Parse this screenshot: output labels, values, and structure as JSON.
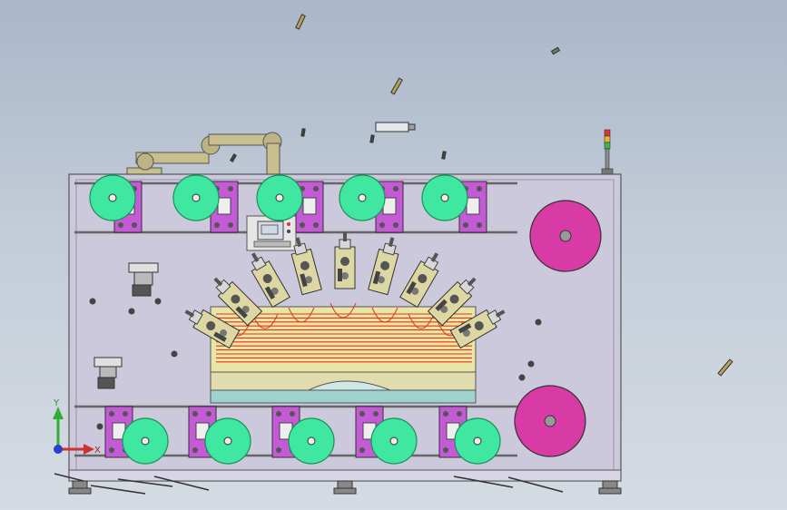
{
  "viewport": {
    "background_top": "#a9b7c9",
    "background_bottom": "#d5dbe3"
  },
  "colors": {
    "frame": "#cdc9dc",
    "roller": "#3fe7a0",
    "roller_rim": "#1a8f5a",
    "bracket": "#c45ad6",
    "big_reel": "#d83aa6",
    "fan_fill": "#e9e5a6",
    "conveyor": "#9fd2cf",
    "strand": "#e2371c",
    "station": "#ddd7a3",
    "arm": "#c8be8e"
  },
  "triad": {
    "y_label": "Y",
    "x_label": "X"
  },
  "model": {
    "top_rollers": 5,
    "bottom_rollers": 5,
    "feeder_stations": 9,
    "big_reels": 2,
    "strands": 13
  }
}
